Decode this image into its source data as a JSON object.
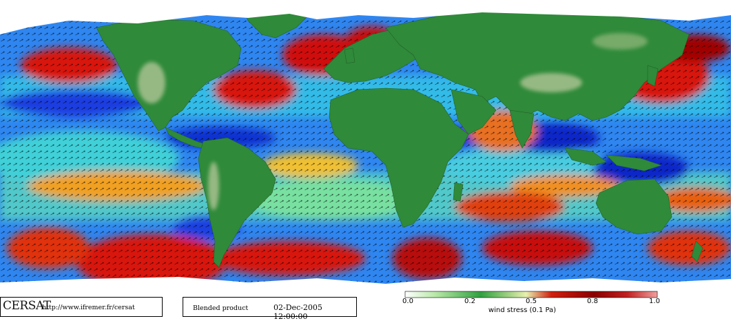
{
  "figure": {
    "logo_text": "CERSAT",
    "url": "http://www.ifremer.fr/cersat",
    "product": "Blended product",
    "datetime": "02-Dec-2005 12:00:00"
  },
  "colorbar": {
    "title": "wind stress (0.1 Pa)",
    "ticks": [
      "0.0",
      "0.2",
      "0.5",
      "0.8",
      "1.0"
    ],
    "range": [
      0.0,
      1.0
    ],
    "colors": [
      "#1010c8",
      "#1e6cff",
      "#1fc8f0",
      "#a8f080",
      "#f0e040",
      "#f07020",
      "#c81010",
      "#7a0000"
    ]
  },
  "map_colors": {
    "ocean_low": "#1e40d8",
    "ocean_mid": "#30c8e8",
    "ocean_high": "#e02010",
    "land": "#2f8a3a",
    "land_high": "#b8c89a",
    "ice": "#ffffff",
    "arrow": "#000000"
  }
}
